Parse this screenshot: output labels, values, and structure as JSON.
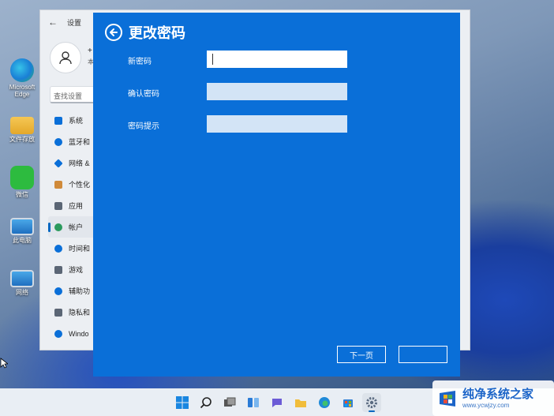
{
  "desktop": {
    "icons": [
      {
        "label": "Microsoft Edge",
        "icon": "edge-icon"
      },
      {
        "label": "文件存放",
        "icon": "folder-icon"
      },
      {
        "label": "微信",
        "icon": "wechat-icon"
      },
      {
        "label": "此电脑",
        "icon": "computer-icon"
      },
      {
        "label": "网络",
        "icon": "network-icon"
      }
    ]
  },
  "settings": {
    "title": "设置",
    "username": "+",
    "username_sub": "本",
    "search_placeholder": "查找设置",
    "nav": [
      {
        "label": "系统",
        "icon": "system-icon",
        "color": "#0a6fd8"
      },
      {
        "label": "蓝牙和",
        "icon": "bluetooth-icon",
        "color": "#0a6fd8"
      },
      {
        "label": "网络 &",
        "icon": "network-icon",
        "color": "#0a6fd8"
      },
      {
        "label": "个性化",
        "icon": "brush-icon",
        "color": "#d08a3a"
      },
      {
        "label": "应用",
        "icon": "apps-icon",
        "color": "#5b6675"
      },
      {
        "label": "帐户",
        "icon": "account-icon",
        "color": "#2b9a5d",
        "active": true
      },
      {
        "label": "时间和",
        "icon": "globe-icon",
        "color": "#0a6fd8"
      },
      {
        "label": "游戏",
        "icon": "game-icon",
        "color": "#5b6675"
      },
      {
        "label": "辅助功",
        "icon": "accessibility-icon",
        "color": "#0a6fd8"
      },
      {
        "label": "隐私和",
        "icon": "shield-icon",
        "color": "#5b6675"
      },
      {
        "label": "Windo",
        "icon": "update-icon",
        "color": "#0a6fd8"
      }
    ]
  },
  "dialog": {
    "title": "更改密码",
    "fields": [
      {
        "label": "新密码",
        "value": ""
      },
      {
        "label": "确认密码",
        "value": ""
      },
      {
        "label": "密码提示",
        "value": ""
      }
    ],
    "next_label": "下一页",
    "cancel_label": ""
  },
  "watermark": {
    "title": "纯净系统之家",
    "url": "www.ycwjzy.com"
  },
  "colors": {
    "dialog_bg": "#0a6fd8",
    "accent": "#0067c0"
  }
}
